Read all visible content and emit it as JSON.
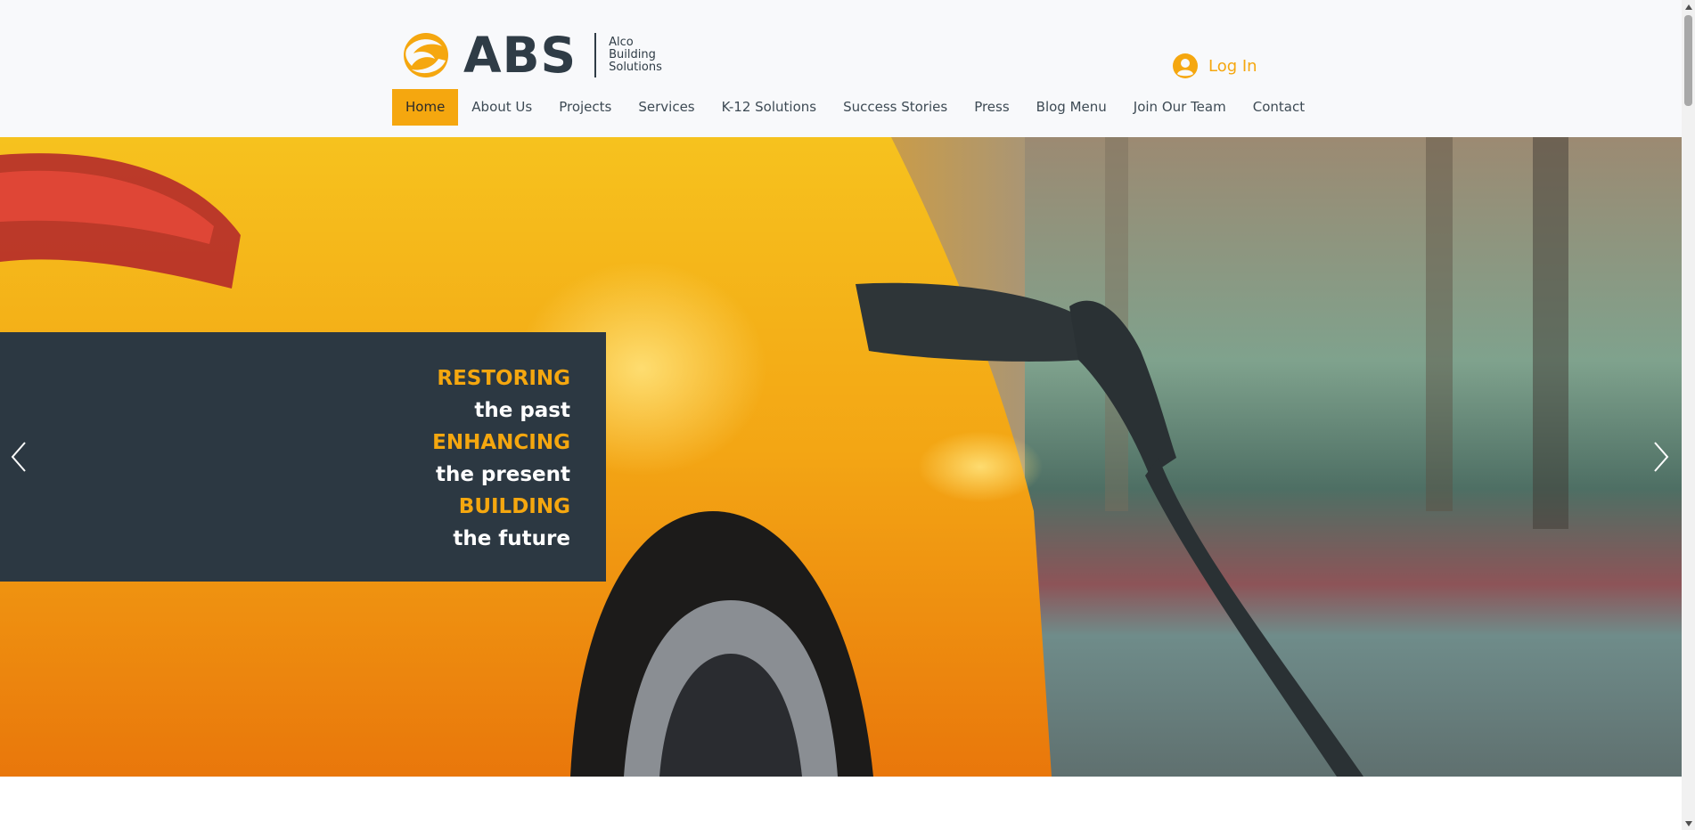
{
  "brand": {
    "name": "ABS",
    "sub_lines": [
      "Alco",
      "Building",
      "Solutions"
    ],
    "accent_color": "#f5a70f",
    "dark_color": "#2f3c46"
  },
  "account": {
    "login_label": "Log In",
    "avatar_icon": "user-avatar-icon"
  },
  "nav": {
    "items": [
      {
        "label": "Home",
        "active": true
      },
      {
        "label": "About Us",
        "active": false
      },
      {
        "label": "Projects",
        "active": false
      },
      {
        "label": "Services",
        "active": false
      },
      {
        "label": "K-12 Solutions",
        "active": false
      },
      {
        "label": "Success Stories",
        "active": false
      },
      {
        "label": "Press",
        "active": false
      },
      {
        "label": "Blog Menu",
        "active": false
      },
      {
        "label": "Join Our Team",
        "active": false
      },
      {
        "label": "Contact",
        "active": false
      }
    ]
  },
  "hero": {
    "image_description_icon": "ev-charging-car-photo",
    "tagline": [
      {
        "text": "RESTORING",
        "style": "accent"
      },
      {
        "text": "the past",
        "style": "light"
      },
      {
        "text": "ENHANCING",
        "style": "accent"
      },
      {
        "text": "the present",
        "style": "light"
      },
      {
        "text": "BUILDING",
        "style": "accent"
      },
      {
        "text": "the future",
        "style": "light"
      }
    ],
    "prev_icon": "chevron-left-icon",
    "next_icon": "chevron-right-icon"
  }
}
